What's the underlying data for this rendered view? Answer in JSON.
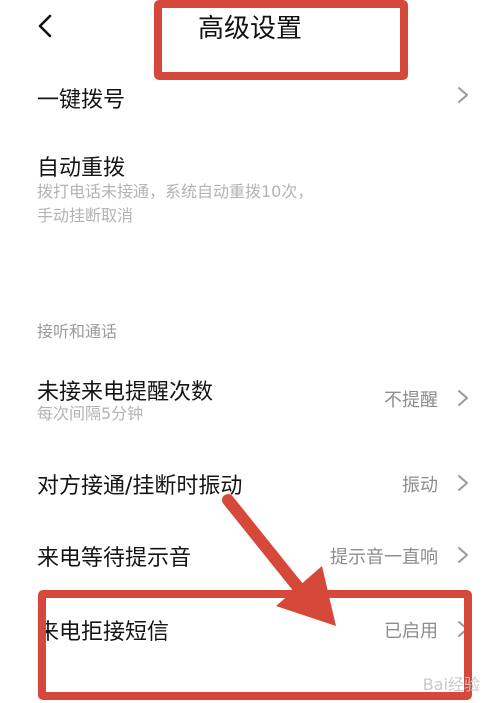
{
  "header": {
    "title": "高级设置",
    "back_icon": "chevron-left-icon"
  },
  "rows": {
    "one_key_dial": {
      "label": "一键拨号"
    },
    "auto_redial": {
      "label": "自动重拨",
      "sub_line1": "拨打电话未接通，系统自动重拨10次，",
      "sub_line2": "手动挂断取消"
    },
    "missed_call_reminder": {
      "label": "未接来电提醒次数",
      "sub": "每次间隔5分钟",
      "value": "不提醒"
    },
    "vibrate_on_connect": {
      "label": "对方接通/挂断时振动",
      "value": "振动"
    },
    "call_waiting_tone": {
      "label": "来电等待提示音",
      "value": "提示音一直响"
    },
    "reject_sms": {
      "label": "来电拒接短信",
      "value": "已启用"
    }
  },
  "section_answer_call": "接听和通话",
  "annotation_color": "#d6483a",
  "watermark": "Bai经验"
}
